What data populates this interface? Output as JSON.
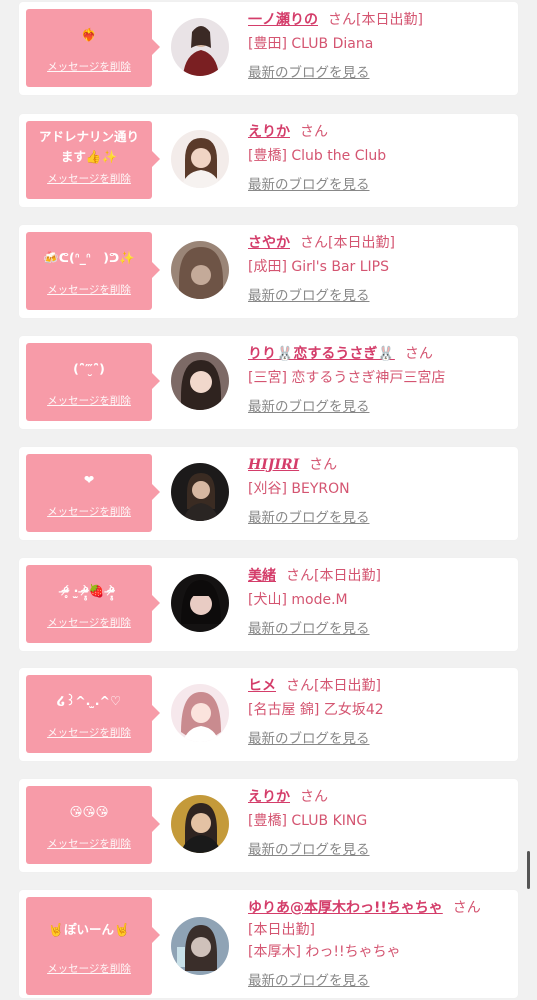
{
  "delete_label": "メッセージを削除",
  "blog_label": "最新のブログを見る",
  "honorific": "さん",
  "cards": [
    {
      "message": "❤️‍🔥",
      "name": "一ノ瀬りの",
      "status": "[本日出勤]",
      "area": "[豊田]",
      "shop": "CLUB Diana",
      "avatar": "person-photo"
    },
    {
      "message": "アドレナリン通り\nます👍✨",
      "name": "えりか",
      "status": "",
      "area": "[豊橋]",
      "shop": "Club the Club",
      "avatar": "person-photo"
    },
    {
      "message": "🍻ᕦ(ᐢ_ᐢ　)ᕤ✨",
      "name": "さやか",
      "status": "[本日出勤]",
      "area": "[成田]",
      "shop": "Girl's Bar LIPS",
      "avatar": "person-photo"
    },
    {
      "message": "(ˆ̑‴̮ˆ̑)",
      "name": "りり🐰恋するうさぎ🐰",
      "status": "",
      "area": "[三宮]",
      "shop": "恋するうさぎ神戸三宮店",
      "avatar": "person-photo"
    },
    {
      "message": "❤",
      "name": "HIJIRI",
      "status": "",
      "area": "[刈谷]",
      "shop": "BEYRON",
      "avatar": "person-photo"
    },
    {
      "message": "ᵒ̴̶̷̥́ ·̫ ᵒ̴̶̷̣̥̀🍓 ᵒ̴̶̷̣̥̀",
      "name": "美緒",
      "status": "[本日出勤]",
      "area": "[犬山]",
      "shop": "mode.M",
      "avatar": "person-photo"
    },
    {
      "message": "໒꒱^. ̫.^♡",
      "name": "ヒメ",
      "status": "[本日出勤]",
      "area": "[名古屋 錦]",
      "shop": "乙女坂42",
      "avatar": "person-photo"
    },
    {
      "message": "😘😘😘",
      "name": "えりか",
      "status": "",
      "area": "[豊橋]",
      "shop": "CLUB KING",
      "avatar": "person-photo"
    },
    {
      "message": "🤘ぽいーん🤘",
      "name": "ゆりあ@本厚木わっ!!ちゃちゃ",
      "status": "[本日出勤]",
      "area": "[本厚木]",
      "shop": "わっ!!ちゃちゃ",
      "avatar": "person-photo"
    }
  ]
}
